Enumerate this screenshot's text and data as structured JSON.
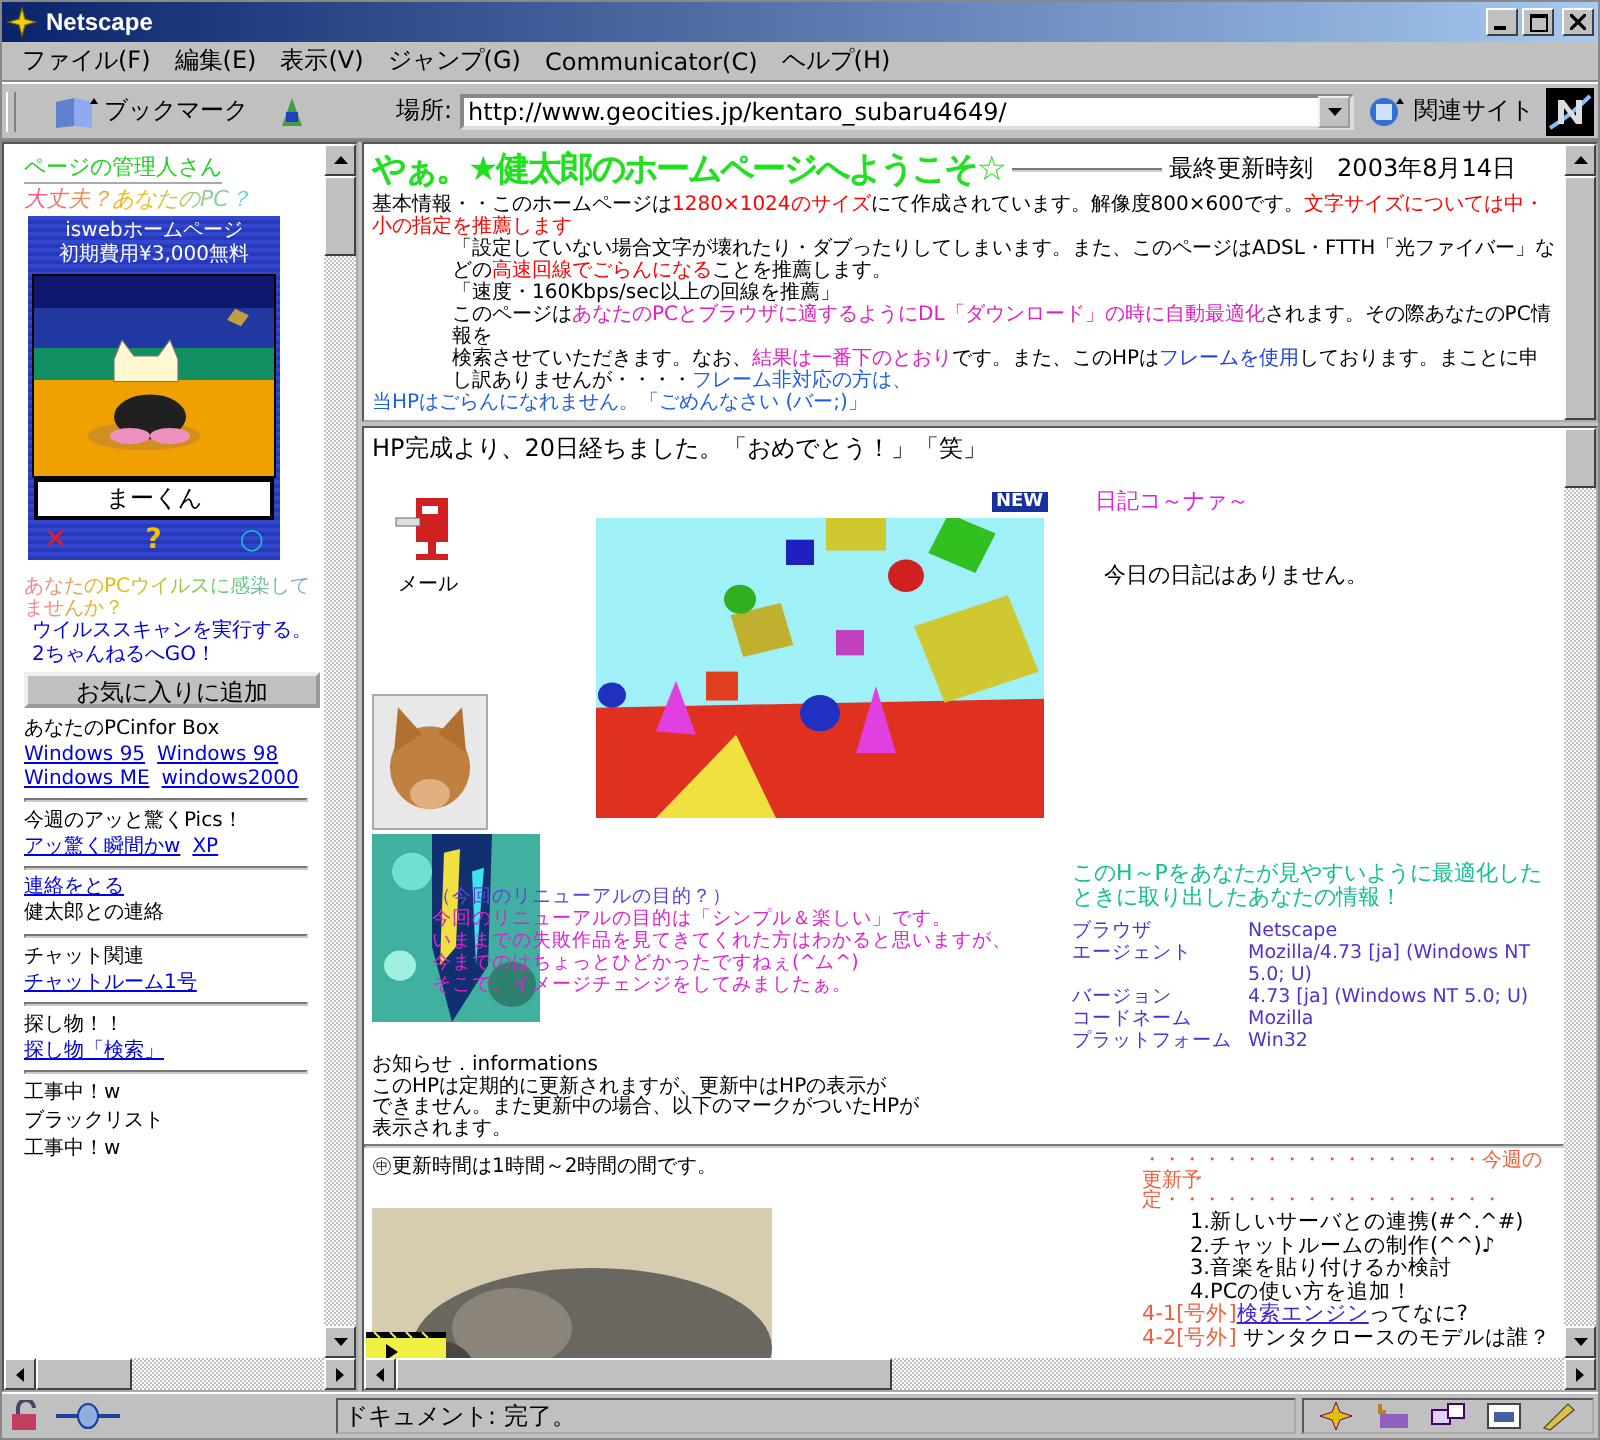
{
  "window": {
    "title": "Netscape"
  },
  "menu": [
    "ファイル(F)",
    "編集(E)",
    "表示(V)",
    "ジャンプ(G)",
    "Communicator(C)",
    "ヘルプ(H)"
  ],
  "toolbar": {
    "bookmarks": "ブックマーク",
    "location_label": "場所:",
    "url": "http://www.geocities.jp/kentaro_subaru4649/",
    "related": "関連サイト"
  },
  "left_frame": {
    "manager": "ページの管理人さん",
    "pc_check": "大丈夫？あなたのPC？",
    "ad": {
      "line1": "iswebホームページ",
      "line2": "初期費用¥3,000無料",
      "name": "まーくん",
      "marks": [
        {
          "text": "✕",
          "color": "#e02020"
        },
        {
          "text": "?",
          "color": "#f0c000"
        },
        {
          "text": "○",
          "color": "#20c0c0"
        }
      ]
    },
    "virus_prompt": "あなたのPCウイルスに感染してませんか？",
    "links_top": [
      "ウイルススキャンを実行する。",
      "2ちゃんねるへGO！"
    ],
    "favorite_button": "お気に入りに追加",
    "items": [
      {
        "kind": "text",
        "text": "あなたのPCinfor Box"
      },
      {
        "kind": "links",
        "links": [
          "Windows 95",
          "Windows 98"
        ]
      },
      {
        "kind": "links",
        "links": [
          "Windows ME",
          "windows2000"
        ]
      },
      {
        "kind": "rule"
      },
      {
        "kind": "text",
        "text": "今週のアッと驚くPics！"
      },
      {
        "kind": "links",
        "links": [
          "アッ驚く瞬間かw",
          "XP"
        ]
      },
      {
        "kind": "rule"
      },
      {
        "kind": "link",
        "text": "連絡をとる"
      },
      {
        "kind": "text",
        "text": "健太郎との連絡"
      },
      {
        "kind": "rule"
      },
      {
        "kind": "text",
        "text": "チャット関連"
      },
      {
        "kind": "link",
        "text": "チャットルーム1号"
      },
      {
        "kind": "rule"
      },
      {
        "kind": "text",
        "text": "探し物！！"
      },
      {
        "kind": "link",
        "text": "探し物「検索」"
      },
      {
        "kind": "rule"
      },
      {
        "kind": "text",
        "text": "工事中！w"
      },
      {
        "kind": "text",
        "text": "ブラックリスト"
      },
      {
        "kind": "text",
        "text": "工事中！w"
      }
    ]
  },
  "top_frame": {
    "title": "やぁ。★健太郎のホームページへようこそ☆",
    "updated": "最終更新時刻　2003年8月14日",
    "info": [
      [
        {
          "text": "基本情報・・このホームページは",
          "color": "#000000"
        },
        {
          "text": "1280×1024のサイズ",
          "color": "#ff0000"
        },
        {
          "text": "にて作成されています。解像度800×600です。",
          "color": "#000000"
        },
        {
          "text": "文字サイズについては中・小の指定を推薦します",
          "color": "#ff0000"
        }
      ],
      [
        {
          "text": "「設定していない場合文字が壊れたり・ダブったりしてしまいます。また、このページはADSL・FTTH「光ファイバー」などの",
          "color": "#000000"
        },
        {
          "text": "高速回線でごらんになる",
          "color": "#ff0000"
        },
        {
          "text": "ことを推薦します。",
          "color": "#000000"
        }
      ],
      [
        {
          "text": "「速度・160Kbps/sec以上の回線を推薦」",
          "color": "#000000"
        }
      ],
      [
        {
          "text": "このページは",
          "color": "#000000"
        },
        {
          "text": "あなたのPCとブラウザに適するようにDL「ダウンロード」の時に自動最適化",
          "color": "#e020c0"
        },
        {
          "text": "されます。その際あなたのPC情報を",
          "color": "#000000"
        }
      ],
      [
        {
          "text": "検索させていただきます。なお、",
          "color": "#000000"
        },
        {
          "text": "結果は一番下のとおり",
          "color": "#e020c0"
        },
        {
          "text": "です。また、このHPは",
          "color": "#000000"
        },
        {
          "text": "フレームを使用",
          "color": "#2040e0"
        },
        {
          "text": "しております。まことに申し訳ありませんが・・・・",
          "color": "#000000"
        },
        {
          "text": "フレーム非対応の方は、",
          "color": "#2060e0"
        }
      ],
      [
        {
          "text": "当HPはごらんになれません。「ごめんなさい (バー;)」",
          "color": "#2060e0"
        }
      ]
    ]
  },
  "main": {
    "heading": "HP完成より、20日経ちました。「おめでとう！」「笑」",
    "mail_label": "メール",
    "new_badge": "NEW",
    "diary_title": "日記コ～ナァ～",
    "diary_text": "今日の日記はありません。",
    "renewal": {
      "title": "（今回のリニューアルの目的？）",
      "lines": [
        "今回のリニューアルの目的は「シンプル＆楽しい」です。",
        "いままでの失敗作品を見てきてくれた方はわかると思いますが、",
        "今までのはちょっとひどかったですねぇ(^ム^)",
        "そこで、イメージチェンジをしてみましたぁ。"
      ]
    },
    "env": {
      "title": "このH～Pをあなたが見やすいように最適化したときに取り出したあなたの情報！",
      "rows": [
        {
          "label": "ブラウザ",
          "value": "Netscape"
        },
        {
          "label": "エージェント",
          "value": "Mozilla/4.73 [ja] (Windows NT 5.0; U)"
        },
        {
          "label": "バージョン",
          "value": "4.73 [ja] (Windows NT 5.0; U)"
        },
        {
          "label": "コードネーム",
          "value": "Mozilla"
        },
        {
          "label": "プラットフォーム",
          "value": "Win32"
        }
      ]
    },
    "notice": [
      "お知らせ．informations",
      "このHPは定期的に更新されますが、更新中はHPの表示が",
      "できません。また更新中の場合、以下のマークがついたHPが",
      "表示されます。"
    ],
    "update_time": "㊥更新時間は1時間～2時間の間です。",
    "schedule": {
      "title": "・・・・・・・・・・・・・・・・・今週の更新予定・・・・・・・・・・・・・・・・・",
      "items": [
        "1.新しいサーバとの連携(#^.^#)",
        "2.チャットルームの制作(^^)♪",
        "3.音楽を貼り付けるか検討",
        "4.PCの使い方を追加！"
      ],
      "extras": [
        {
          "tag": "4-1[号外]",
          "link": "検索エンジン",
          "text": "ってなに?"
        },
        {
          "tag": "4-2[号外]",
          "text": " サンタクロースのモデルは誰？"
        }
      ]
    }
  },
  "status_bar": {
    "text": "ドキュメント: 完了。"
  }
}
